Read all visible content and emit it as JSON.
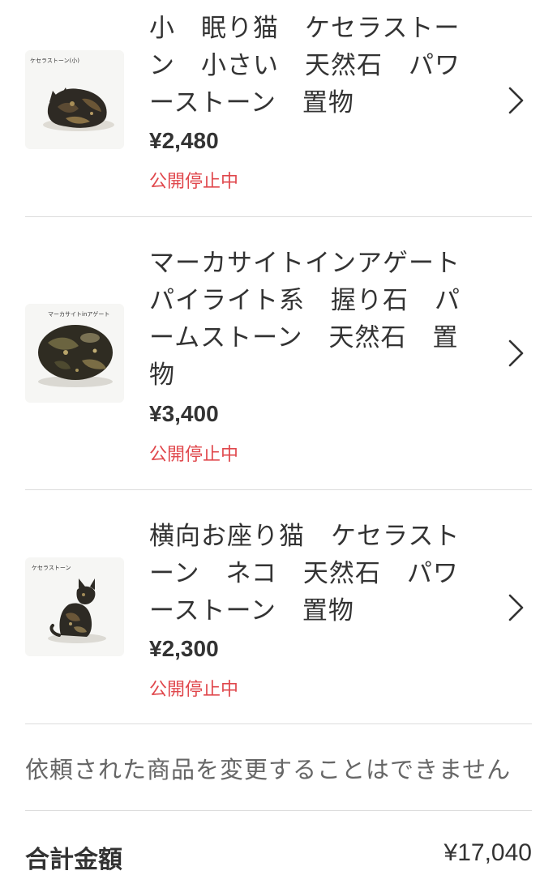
{
  "items": [
    {
      "title": "小　眠り猫　ケセラストーン　小さい　天然石　パワーストーン　置物",
      "price": "¥2,480",
      "status": "公開停止中",
      "thumb_caption": "ケセラストーン(小)"
    },
    {
      "title": "マーカサイトインアゲートパイライト系　握り石　パームストーン　天然石　置物",
      "price": "¥3,400",
      "status": "公開停止中",
      "thumb_caption": "マーカサイトinアゲート"
    },
    {
      "title": "横向お座り猫　ケセラストーン　ネコ　天然石　パワーストーン　置物",
      "price": "¥2,300",
      "status": "公開停止中",
      "thumb_caption": "ケセラストーン"
    }
  ],
  "notice": "依頼された商品を変更することはできません",
  "total": {
    "label": "合計金額",
    "value": "¥17,040"
  },
  "icons": {
    "chevron": "chevron-right-icon"
  },
  "colors": {
    "status": "#e0484d",
    "text": "#333333",
    "divider": "#dcdcdc"
  }
}
